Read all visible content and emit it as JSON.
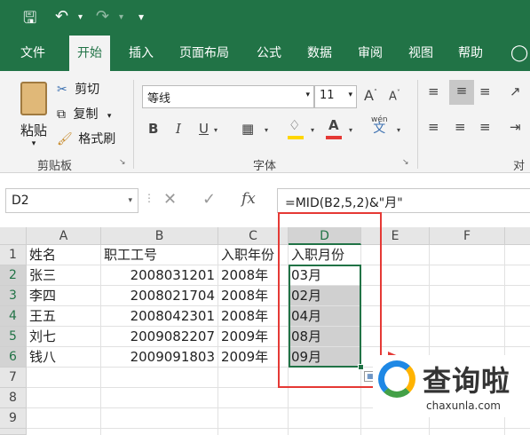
{
  "qat": {
    "save_icon": "save-icon",
    "undo_icon": "undo-icon",
    "redo_icon": "redo-icon",
    "customize_icon": "customize-icon"
  },
  "tabs": [
    "文件",
    "开始",
    "插入",
    "页面布局",
    "公式",
    "数据",
    "审阅",
    "视图",
    "帮助"
  ],
  "ribbon": {
    "clipboard": {
      "paste": "粘贴",
      "cut": "剪切",
      "copy": "复制",
      "format_painter": "格式刷",
      "label": "剪贴板"
    },
    "font": {
      "name": "等线",
      "size": "11",
      "label": "字体",
      "bold": "B",
      "italic": "I",
      "underline": "U",
      "wen": "wén",
      "wen_char": "文"
    },
    "align": {
      "label": "对齐"
    }
  },
  "formula_bar": {
    "name_box": "D2",
    "fx": "fx",
    "formula": "=MID(B2,5,2)&\"月\""
  },
  "columns": [
    "A",
    "B",
    "C",
    "D",
    "E",
    "F"
  ],
  "rows": [
    "1",
    "2",
    "3",
    "4",
    "5",
    "6",
    "7",
    "8",
    "9"
  ],
  "cells": {
    "r1": [
      "姓名",
      "职工工号",
      "入职年份",
      "入职月份"
    ],
    "r2": [
      "张三",
      "2008031201",
      "2008年",
      "03月"
    ],
    "r3": [
      "李四",
      "2008021704",
      "2008年",
      "02月"
    ],
    "r4": [
      "王五",
      "2008042301",
      "2008年",
      "04月"
    ],
    "r5": [
      "刘七",
      "2009082207",
      "2009年",
      "08月"
    ],
    "r6": [
      "钱八",
      "2009091803",
      "2009年",
      "09月"
    ]
  },
  "watermark": {
    "title": "查询啦",
    "url": "chaxunla.com"
  },
  "colors": {
    "excel_green": "#217346",
    "highlight_red": "#e53935",
    "fill_yellow": "#ffd600",
    "font_red": "#e53935"
  }
}
